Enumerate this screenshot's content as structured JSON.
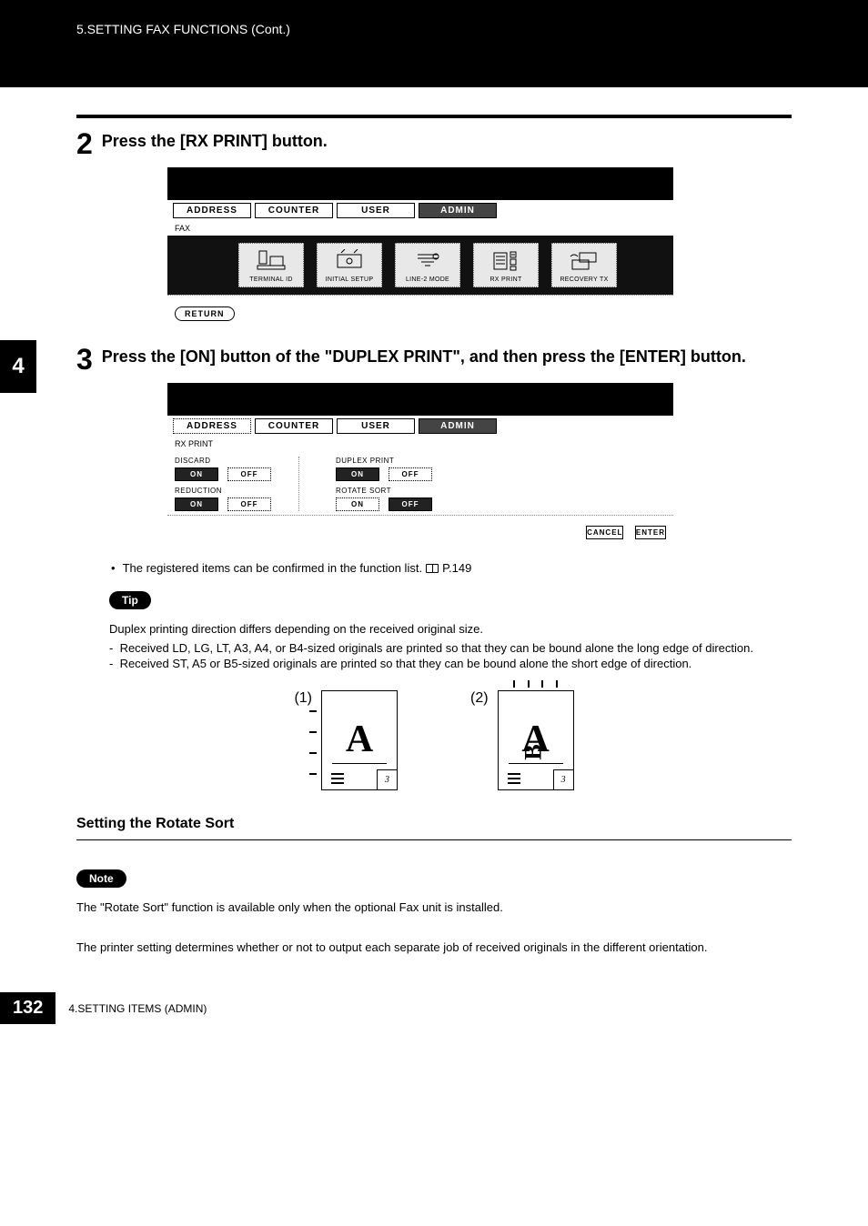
{
  "header": {
    "chapter_title": "5.SETTING FAX FUNCTIONS (Cont.)"
  },
  "side_tab": "4",
  "steps": {
    "s2": {
      "num": "2",
      "text": "Press the [RX PRINT] button."
    },
    "s3": {
      "num": "3",
      "text": "Press the [ON] button of the \"DUPLEX PRINT\", and then press the [ENTER] button."
    }
  },
  "screen1": {
    "tabs": {
      "address": "ADDRESS",
      "counter": "COUNTER",
      "user": "USER",
      "admin": "ADMIN"
    },
    "label": "FAX",
    "icons": {
      "terminal": "TERMINAL ID",
      "initial": "INITIAL SETUP",
      "line2": "LINE-2 MODE",
      "rxprint": "RX PRINT",
      "recovery": "RECOVERY TX"
    },
    "return": "RETURN"
  },
  "screen2": {
    "tabs": {
      "address": "ADDRESS",
      "counter": "COUNTER",
      "user": "USER",
      "admin": "ADMIN"
    },
    "label": "RX PRINT",
    "groups": {
      "discard": {
        "title": "DISCARD",
        "on": "ON",
        "off": "OFF"
      },
      "reduction": {
        "title": "REDUCTION",
        "on": "ON",
        "off": "OFF"
      },
      "duplex": {
        "title": "DUPLEX PRINT",
        "on": "ON",
        "off": "OFF"
      },
      "rotate": {
        "title": "ROTATE SORT",
        "on": "ON",
        "off": "OFF"
      }
    },
    "cancel": "CANCEL",
    "enter": "ENTER"
  },
  "registered_line": {
    "prefix": "The registered items can be confirmed in the function list.",
    "pageref": "P.149"
  },
  "tip": {
    "label": "Tip",
    "line1": "Duplex printing direction differs depending on the received original size.",
    "d1": "Received LD, LG, LT, A3, A4, or B4-sized originals are printed so that they can be bound alone the long edge of direction.",
    "d2": "Received ST, A5 or B5-sized originals are printed so that they can be bound alone the short edge of direction."
  },
  "diagram": {
    "n1": "(1)",
    "n2": "(2)",
    "A": "A",
    "B": "B",
    "page3": "3"
  },
  "section": {
    "heading": "Setting the Rotate Sort"
  },
  "note": {
    "label": "Note",
    "body": "The \"Rotate Sort\" function is available only when the optional Fax unit is installed."
  },
  "description": "The printer setting determines whether or not to output each separate job of received originals in the different orientation.",
  "footer": {
    "page": "132",
    "text": "4.SETTING ITEMS (ADMIN)"
  }
}
